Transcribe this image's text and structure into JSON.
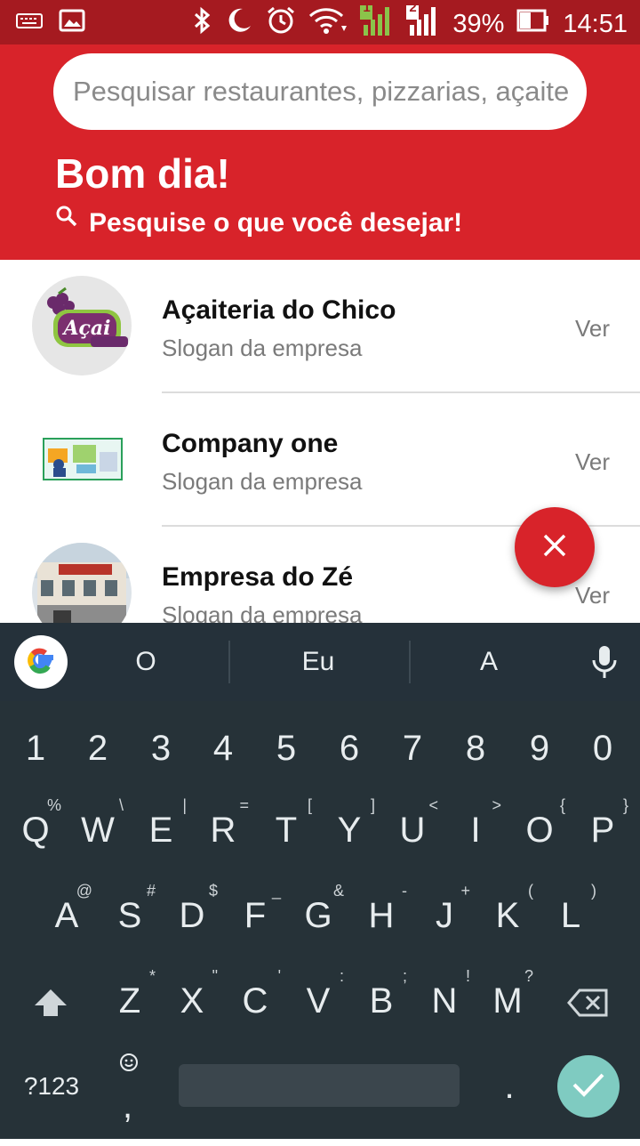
{
  "status_bar": {
    "battery": "39%",
    "time": "14:51",
    "sim1": "1",
    "sim2": "2"
  },
  "search": {
    "placeholder": "Pesquisar restaurantes, pizzarias, açaiterias..."
  },
  "header": {
    "greeting": "Bom dia!",
    "subtitle": "Pesquise o que você desejar!"
  },
  "companies": [
    {
      "name": "Açaiteria do Chico",
      "slogan": "Slogan da empresa",
      "action": "Ver",
      "logo_text": "Açai"
    },
    {
      "name": "Company one",
      "slogan": "Slogan da empresa",
      "action": "Ver"
    },
    {
      "name": "Empresa do Zé",
      "slogan": "Slogan da empresa",
      "action": "Ver"
    }
  ],
  "keyboard": {
    "suggestions": [
      "O",
      "Eu",
      "A"
    ],
    "number_row": [
      "1",
      "2",
      "3",
      "4",
      "5",
      "6",
      "7",
      "8",
      "9",
      "0"
    ],
    "row1": [
      "Q",
      "W",
      "E",
      "R",
      "T",
      "Y",
      "U",
      "I",
      "O",
      "P"
    ],
    "row1_hints": [
      "%",
      "\\",
      "|",
      "=",
      "[",
      "]",
      "<",
      ">",
      "{",
      "}"
    ],
    "row2": [
      "A",
      "S",
      "D",
      "F",
      "G",
      "H",
      "J",
      "K",
      "L"
    ],
    "row2_hints": [
      "@",
      "#",
      "$",
      "_",
      "&",
      "-",
      "+",
      "(",
      ")"
    ],
    "row3": [
      "Z",
      "X",
      "C",
      "V",
      "B",
      "N",
      "M"
    ],
    "row3_hints": [
      "*",
      "\"",
      "'",
      ":",
      ";",
      "!",
      "?"
    ],
    "symbols_key": "?123",
    "comma_key": ",",
    "period_key": "."
  },
  "colors": {
    "status_bar": "#a51a20",
    "header": "#d8232a",
    "keyboard_bg": "#263238",
    "enter_key": "#7fcbc1"
  }
}
